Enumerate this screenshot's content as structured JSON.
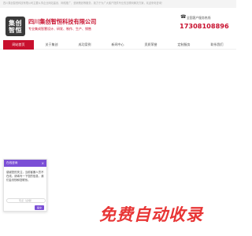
{
  "topbar": {
    "text": "四川集创智恒科技有限公司主要从事企业网站建设、网络推广、营销策划等服务，致力于为广大客户提供专业的互联网解决方案，欢迎来电咨询！"
  },
  "header": {
    "logo_line1": "集创",
    "logo_line2": "智恒",
    "company_name": "四川集创智恒科技有限公司",
    "company_sub": "专业集成智慧设计、研发、制作、生产、销售",
    "hotline_label": "全国客户服务热线",
    "hotline_number": "17308108896"
  },
  "nav": {
    "items": [
      {
        "label": "网站首页",
        "active": true
      },
      {
        "label": "关于集创",
        "active": false
      },
      {
        "label": "成功案例",
        "active": false
      },
      {
        "label": "新闻中心",
        "active": false
      },
      {
        "label": "资质荣誉",
        "active": false
      },
      {
        "label": "定制服务",
        "active": false
      },
      {
        "label": "联系我们",
        "active": false
      }
    ]
  },
  "chat": {
    "title": "在线咨询",
    "message": "感谢您的关注，当前客服人员不在线，请填写一下您的信息，我们会尽快和您联系。",
    "input_placeholder": "写点（必填）",
    "send_label": "提交"
  },
  "watermark": {
    "text": "免费自动收录"
  }
}
